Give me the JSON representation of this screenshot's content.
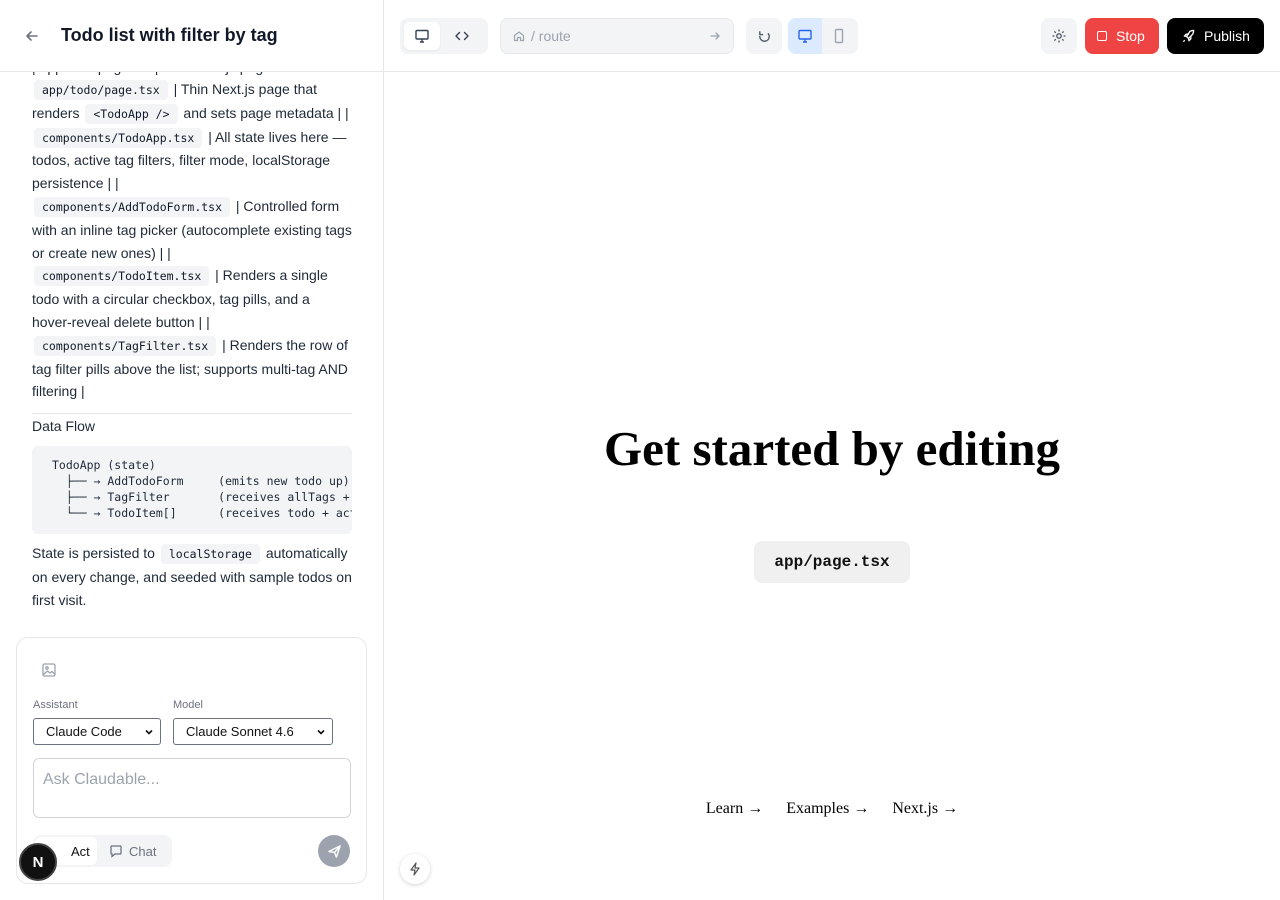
{
  "header": {
    "title": "Todo list with filter by tag"
  },
  "message": {
    "clipped_line": "| app/todo/page.tsx | Thin Next.js page",
    "row1_code": "app/todo/page.tsx",
    "row1_text_a": "| Thin Next.js page that renders",
    "row1_code2": "<TodoApp />",
    "row1_text_b": "and sets page metadata | |",
    "row2_code": "components/TodoApp.tsx",
    "row2_text": "| All state lives here — todos, active tag filters, filter mode, localStorage persistence | |",
    "row3_code": "components/AddTodoForm.tsx",
    "row3_text": "| Controlled form with an inline tag picker (autocomplete existing tags or create new ones) | |",
    "row4_code": "components/TodoItem.tsx",
    "row4_text": "| Renders a single todo with a circular checkbox, tag pills, and a hover-reveal delete button | |",
    "row5_code": "components/TagFilter.tsx",
    "row5_text": "| Renders the row of tag filter pills above the list; supports multi-tag AND filtering |",
    "data_flow_heading": "Data Flow",
    "data_flow_code": "TodoApp (state)\n  ├── → AddTodoForm     (emits new todo up)\n  ├── → TagFilter       (receives allTags + activeTags)\n  └── → TodoItem[]      (receives todo + actions)",
    "persist_text_a": "State is persisted to",
    "persist_code": "localStorage",
    "persist_text_b": "automatically on every change, and seeded with sample todos on first visit."
  },
  "composer": {
    "assistant_label": "Assistant",
    "assistant_value": "Claude Code",
    "model_label": "Model",
    "model_value": "Claude Sonnet 4.6",
    "placeholder": "Ask Claudable...",
    "mode_act": "Act",
    "mode_chat": "Chat"
  },
  "toolbar": {
    "route_placeholder": "/ route",
    "stop_label": "Stop",
    "publish_label": "Publish"
  },
  "preview": {
    "hero": "Get started by editing",
    "path": "app/page.tsx",
    "links": [
      "Learn →",
      "Examples →",
      "Next.js →"
    ]
  },
  "badge": {
    "letter": "N"
  },
  "colors": {
    "stop": "#ef4444",
    "publish": "#000000",
    "device_active": "#2563eb"
  },
  "icons": [
    "back-arrow-icon",
    "monitor-icon",
    "code-icon",
    "home-icon",
    "arrow-right-icon",
    "refresh-icon",
    "desktop-icon",
    "mobile-icon",
    "gear-icon",
    "stop-icon",
    "rocket-icon",
    "image-icon",
    "chevron-down-icon",
    "chat-bubble-icon",
    "send-icon",
    "bolt-icon"
  ]
}
